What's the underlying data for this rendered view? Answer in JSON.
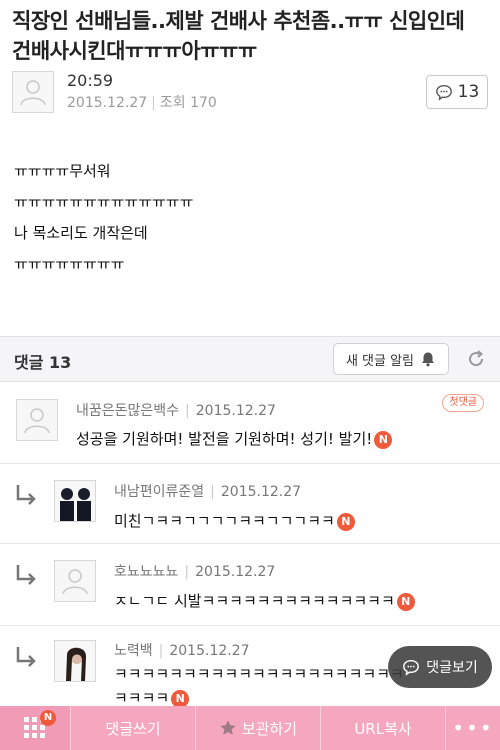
{
  "post": {
    "title": "직장인 선배님들..제발 건배사 추천좀..ㅠㅠ 신입인데 건배사시킨대ㅠㅠㅠ아ㅠㅠㅠ",
    "time": "20:59",
    "date": "2015.12.27",
    "views_label": "조회 170",
    "comment_count": "13",
    "content_lines": [
      "ㅠㅠㅠㅠ무서워",
      "ㅠㅠㅠㅠㅠㅠㅠㅠㅠㅠㅠㅠㅠ",
      "나 목소리도 개작은데",
      "ㅠㅠㅠㅠㅠㅠㅠㅠ"
    ]
  },
  "comments_header": {
    "label": "댓글 13",
    "notify_label": "새 댓글 알림"
  },
  "comments": [
    {
      "author": "내꿈은돈많은백수",
      "date": "2015.12.27",
      "text": "성공을 기원하며! 발전을 기원하며! 성기! 발기!",
      "badge": "첫댓글",
      "new": "N"
    },
    {
      "author": "내남편이류준열",
      "date": "2015.12.27",
      "text": "미친ㄱㅋㅋㄱㄱㄱㄱㅋㅋㄱㄱㄱㅋㅋ",
      "new": "N"
    },
    {
      "author": "호뇨뇨뇨뇨",
      "date": "2015.12.27",
      "text": "ㅈㄴㄱㄷ 시발ㅋㅋㅋㅋㅋㅋㅋㅋㅋㅋㅋㅋㅋㅋ",
      "new": "N"
    },
    {
      "author": "노력백",
      "date": "2015.12.27",
      "text": "ㅋㅋㅋㅋㅋㅋㅋㅋㅋㅋㅋㅋㅋㅋㅋㅋㅋㅋㅋㅋㅋ",
      "text2": "ㅋㅋㅋㅋ",
      "new": "N"
    }
  ],
  "float_button": {
    "label": "댓글보기"
  },
  "toolbar": {
    "new_badge": "N",
    "write_comment": "댓글쓰기",
    "save": "보관하기",
    "copy_url": "URL복사",
    "more": "•••"
  },
  "colors": {
    "accent_pink": "#f5a7bf",
    "new_badge": "#ef5a3c"
  }
}
